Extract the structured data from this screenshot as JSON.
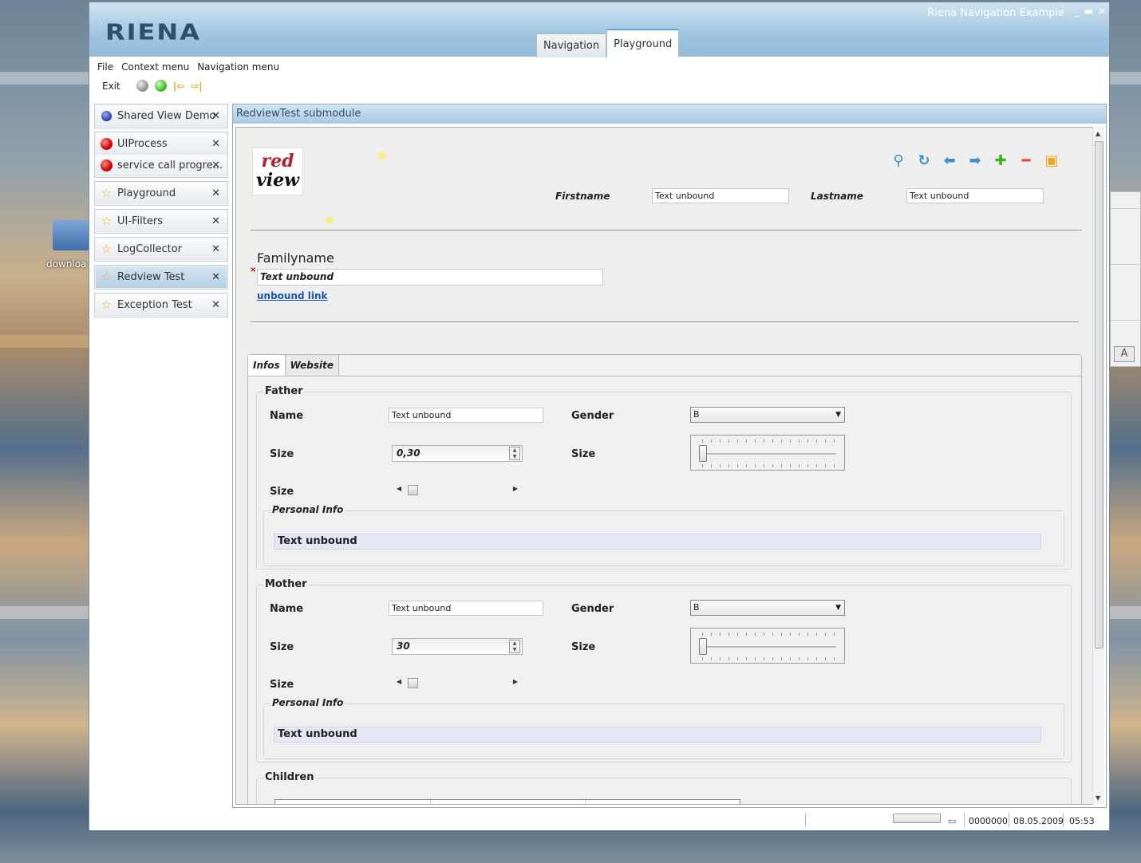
{
  "desktop": {
    "folder_label": "downloa"
  },
  "window": {
    "title": "Riena Navigation Example",
    "logo_text": "RIENA",
    "controls": [
      "_",
      "▬",
      "✕"
    ],
    "app_tabs": [
      {
        "label": "Navigation",
        "active": false
      },
      {
        "label": "Playground",
        "active": true
      }
    ]
  },
  "menubar": {
    "file": "File",
    "context": "Context menu",
    "navigation": "Navigation menu"
  },
  "toolbar": {
    "exit": "Exit"
  },
  "nav": {
    "groups": [
      {
        "items": [
          {
            "label": "Shared View Demo",
            "icon": "blue-globe-icon",
            "active": false
          }
        ]
      },
      {
        "items": [
          {
            "label": "UIProcess",
            "icon": "red-ball-icon",
            "active": false
          },
          {
            "label": "service call progre...",
            "icon": "red-ball-icon",
            "active": false
          }
        ]
      },
      {
        "items": [
          {
            "label": "Playground",
            "icon": "star-icon",
            "active": false
          }
        ]
      },
      {
        "items": [
          {
            "label": "UI-Filters",
            "icon": "star-icon",
            "active": false
          }
        ]
      },
      {
        "items": [
          {
            "label": "LogCollector",
            "icon": "star-icon",
            "active": false
          }
        ]
      },
      {
        "items": [
          {
            "label": "Redview Test",
            "icon": "star-icon",
            "active": true
          }
        ]
      },
      {
        "items": [
          {
            "label": "Exception Test",
            "icon": "star-icon",
            "active": false
          }
        ]
      }
    ],
    "close_glyph": "✕"
  },
  "content": {
    "header": "RedviewTest submodule",
    "logo_line1": "red",
    "logo_line2": "view",
    "firstname_label": "Firstname",
    "firstname_value": "Text unbound",
    "lastname_label": "Lastname",
    "lastname_value": "Text unbound",
    "familyname_label": "Familyname",
    "familyname_value": "Text unbound",
    "required_mark": "×",
    "link_text": "unbound link",
    "tabs": [
      {
        "label": "Infos",
        "active": true
      },
      {
        "label": "Website",
        "active": false
      }
    ],
    "father": {
      "title": "Father",
      "name_label": "Name",
      "name_value": "Text unbound",
      "gender_label": "Gender",
      "gender_value": "B",
      "size_label": "Size",
      "spinner_value": "0,30",
      "slider_label": "Size",
      "scroll_label": "Size",
      "pinfo_title": "Personal Info",
      "pinfo_value": "Text unbound"
    },
    "mother": {
      "title": "Mother",
      "name_label": "Name",
      "name_value": "Text unbound",
      "gender_label": "Gender",
      "gender_value": "B",
      "size_label": "Size",
      "spinner_value": "30",
      "slider_label": "Size",
      "scroll_label": "Size",
      "pinfo_title": "Personal Info",
      "pinfo_value": "Text unbound"
    },
    "children_title": "Children"
  },
  "statusbar": {
    "number": "0000000",
    "date": "08.05.2009",
    "time": "05:53"
  },
  "colors": {
    "accent": "#6aa0cf",
    "link": "#1a55b8",
    "logo": "#2f4f6a"
  }
}
